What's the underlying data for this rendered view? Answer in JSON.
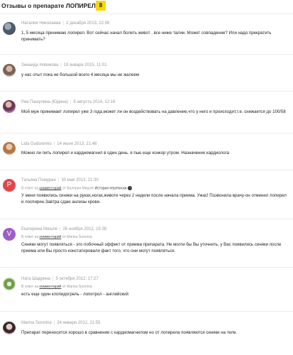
{
  "header": {
    "title": "Отзывы о препарате ЛОПИРЕЛ",
    "count": "8"
  },
  "reviews": [
    {
      "author": "Наталия Николаева",
      "date": "2 декабря 2013, 22:06",
      "avatar": "user-photo-icon",
      "text": "1, 5 месяца принимаю лопирел. Вот сейчас начал болеть живот , все ниже талии. Может совпадение? Или надо прекратить принимать?"
    },
    {
      "author": "Зинаида Новикова",
      "date": "19 января 2015, 11:01",
      "avatar": "user-photo-icon",
      "text": "у нас отыт пока не большой всего 4 месяца мы не жалеем"
    },
    {
      "author": "Рая Пашулина (Юдина)",
      "date": "9 августа 2014, 12:16",
      "avatar": "user-photo-icon",
      "text": "Мой муж принимает лопирел уже 3 года,может ли он воздействовать на давление,что у него и происходит,т.е. снижается до 100/58"
    },
    {
      "author": "Lida Gudorenko",
      "date": "14 июня 2013, 21:48",
      "avatar": "user-photo-icon",
      "text": "Можно ли пить лопирел и кардиомагнил в один день. я пью еще конкор утром. Назначение кардиолога"
    },
    {
      "author": "Татьяна Помуран",
      "date": "30 мая 2013, 21:30",
      "avatar_letter": "P",
      "avatar_color": "#e0474c",
      "reply_prefix": "В ответ на",
      "reply_link": "комментарий",
      "reply_to": "от Валерия Мишле",
      "history_link": "История переписки",
      "text": "У меня появились синяки на руках,ногах,животе через 2 недели после начала приема. Ужас! Позвонила врачу-он отменил лопирел и лоспирин.Завтра сдаю анлизы крови."
    },
    {
      "author": "Екатерина Мишле",
      "date": "26 ноября 2012, 15:38",
      "avatar_letter": "V",
      "avatar_color": "#9c5fc4",
      "reply_prefix": "В ответ на",
      "reply_link": "комментарий",
      "reply_to": "от Marina Sororina",
      "text": "Синяки могут появляться - это побочный эффект от приема препарата. Не могли бы Вы уточнить, у Вас появились синяки после приема или Вы просто констатировали факт того, что они могут появляться."
    },
    {
      "author": "Ната Шадрина",
      "date": "5 октября 2012, 17:27",
      "avatar": "user-photo-icon",
      "reply_prefix": "В ответ на",
      "reply_link": "комментарий",
      "reply_to": "от Marina Sororina",
      "text": "есть еще один клопидогрель - лопитрол - английский"
    },
    {
      "author": "Marina Sororina",
      "date": "24 января 2012, 21:55",
      "avatar": "user-photo-icon",
      "text": "Препарат переносится хорошо в сравнении с кардиомагнилом но от лопирела появляются синяки на теле."
    }
  ]
}
